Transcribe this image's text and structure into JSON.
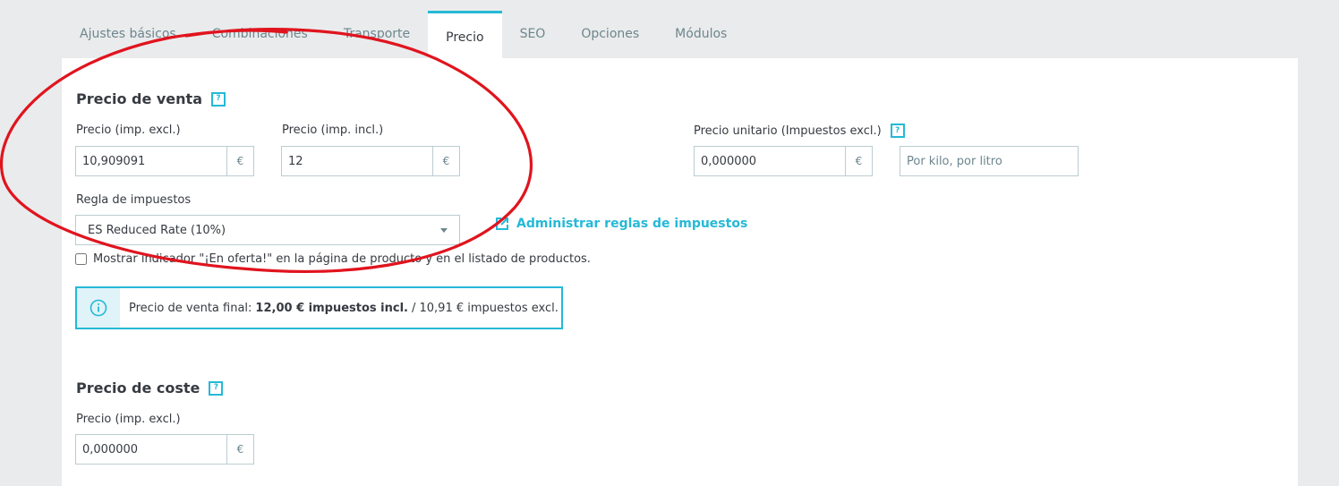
{
  "tabs": [
    {
      "label": "Ajustes básicos",
      "active": false
    },
    {
      "label": "Combinaciones",
      "active": false
    },
    {
      "label": "Transporte",
      "active": false
    },
    {
      "label": "Precio",
      "active": true
    },
    {
      "label": "SEO",
      "active": false
    },
    {
      "label": "Opciones",
      "active": false
    },
    {
      "label": "Módulos",
      "active": false
    }
  ],
  "sale": {
    "title": "Precio de venta",
    "price_excl_label": "Precio (imp. excl.)",
    "price_excl_value": "10,909091",
    "price_incl_label": "Precio (imp. incl.)",
    "price_incl_value": "12",
    "currency": "€",
    "unit_price_label": "Precio unitario (Impuestos excl.)",
    "unit_price_value": "0,000000",
    "unit_placeholder": "Por kilo, por litro",
    "tax_rule_label": "Regla de impuestos",
    "tax_rule_value": "ES Reduced Rate (10%)",
    "manage_tax_link": "Administrar reglas de impuestos",
    "on_sale_checkbox": "Mostrar indicador \"¡En oferta!\" en la página de producto y en el listado de productos.",
    "on_sale_checked": false,
    "final_prefix": "Precio de venta final:",
    "final_incl": "12,00 € impuestos incl.",
    "final_excl": "/ 10,91 € impuestos excl."
  },
  "cost": {
    "title": "Precio de coste",
    "price_label": "Precio (imp. excl.)",
    "price_value": "0,000000",
    "currency": "€"
  },
  "help_glyph": "?",
  "colors": {
    "accent": "#25b9d7",
    "annotation": "#e0141e",
    "page_bg": "#eaebec",
    "text": "#363a41",
    "muted": "#6c868e",
    "border": "#bbcdd2"
  },
  "icons": [
    "help-icon",
    "external-link-icon",
    "info-icon",
    "chevron-down-icon"
  ]
}
